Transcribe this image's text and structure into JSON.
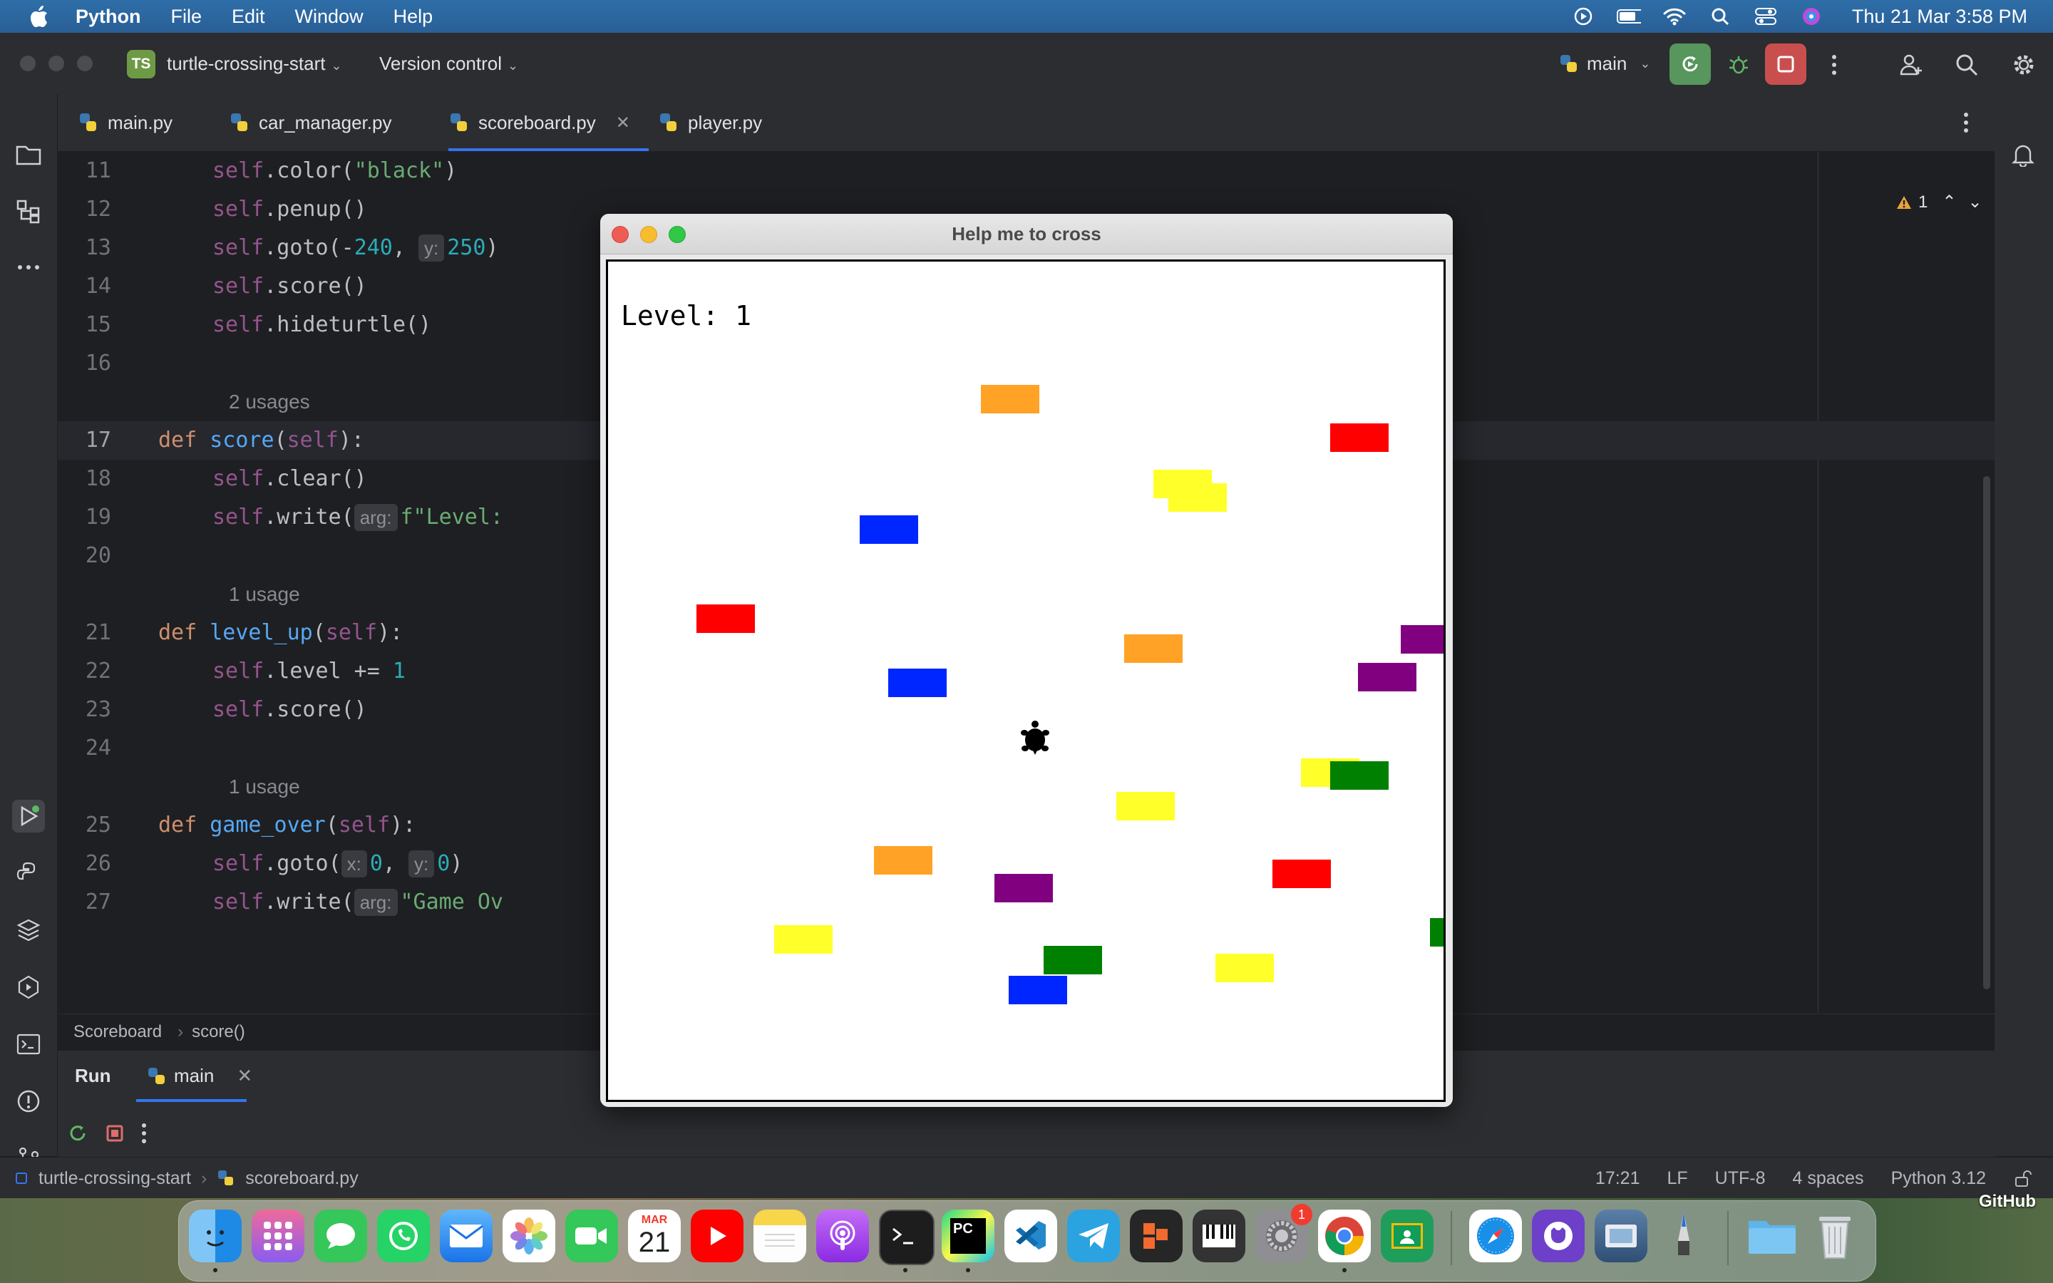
{
  "menubar": {
    "app": "Python",
    "items": [
      "File",
      "Edit",
      "Window",
      "Help"
    ],
    "clock": "Thu 21 Mar  3:58 PM"
  },
  "ide": {
    "project_badge": "TS",
    "project_name": "turtle-crossing-start",
    "vcs_label": "Version control",
    "branch": "main",
    "tabs": [
      {
        "label": "main.py"
      },
      {
        "label": "car_manager.py"
      },
      {
        "label": "scoreboard.py"
      },
      {
        "label": "player.py"
      }
    ],
    "warning_count": "1",
    "code": {
      "l11": {
        "ln": "11",
        "a": "self",
        "b": ".color(",
        "c": "\"black\"",
        "d": ")"
      },
      "l12": {
        "ln": "12",
        "a": "self",
        "b": ".penup()"
      },
      "l13": {
        "ln": "13",
        "a": "self",
        "b": ".goto(-",
        "c": "240",
        "d": ", ",
        "hint": "y:",
        "e": "250",
        "f": ")"
      },
      "l14": {
        "ln": "14",
        "a": "self",
        "b": ".score()"
      },
      "l15": {
        "ln": "15",
        "a": "self",
        "b": ".hideturtle()"
      },
      "l16": {
        "ln": "16"
      },
      "usage1": "2 usages",
      "l17": {
        "ln": "17",
        "kw": "def ",
        "fn": "score",
        "p1": "(",
        "slf": "self",
        "p2": "):"
      },
      "l18": {
        "ln": "18",
        "a": "self",
        "b": ".clear()"
      },
      "l19": {
        "ln": "19",
        "a": "self",
        "b": ".write(",
        "hint": "arg:",
        "c": "f\"Level:"
      },
      "l20": {
        "ln": "20"
      },
      "usage2": "1 usage",
      "l21": {
        "ln": "21",
        "kw": "def ",
        "fn": "level_up",
        "p1": "(",
        "slf": "self",
        "p2": "):"
      },
      "l22": {
        "ln": "22",
        "a": "self",
        "b": ".level += ",
        "c": "1"
      },
      "l23": {
        "ln": "23",
        "a": "self",
        "b": ".score()"
      },
      "l24": {
        "ln": "24"
      },
      "usage3": "1 usage",
      "l25": {
        "ln": "25",
        "kw": "def ",
        "fn": "game_over",
        "p1": "(",
        "slf": "self",
        "p2": "):"
      },
      "l26": {
        "ln": "26",
        "a": "self",
        "b": ".goto(",
        "hint1": "x:",
        "c": "0",
        "d": ", ",
        "hint2": "y:",
        "e": "0",
        "f": ")"
      },
      "l27": {
        "ln": "27",
        "a": "self",
        "b": ".write(",
        "hint": "arg:",
        "c": "\"Game Ov"
      }
    },
    "breadcrumb": [
      "Scoreboard",
      "score()"
    ],
    "run": {
      "title": "Run",
      "tab": "main"
    },
    "status": {
      "project": "turtle-crossing-start",
      "file": "scoreboard.py",
      "position": "17:21",
      "line_sep": "LF",
      "encoding": "UTF-8",
      "indent": "4 spaces",
      "interpreter": "Python 3.12"
    }
  },
  "turtle_window": {
    "title": "Help me to cross",
    "level_text": "Level: 1",
    "colors": {
      "red": "#ff0000",
      "orange": "#ffa226",
      "yellow": "#ffff2a",
      "blue": "#0026ff",
      "purple": "#800080",
      "green": "#008000"
    }
  },
  "dock": {
    "calendar_month": "MAR",
    "calendar_day": "21",
    "settings_badge": "1",
    "wallpaper_label": "GitHub"
  }
}
